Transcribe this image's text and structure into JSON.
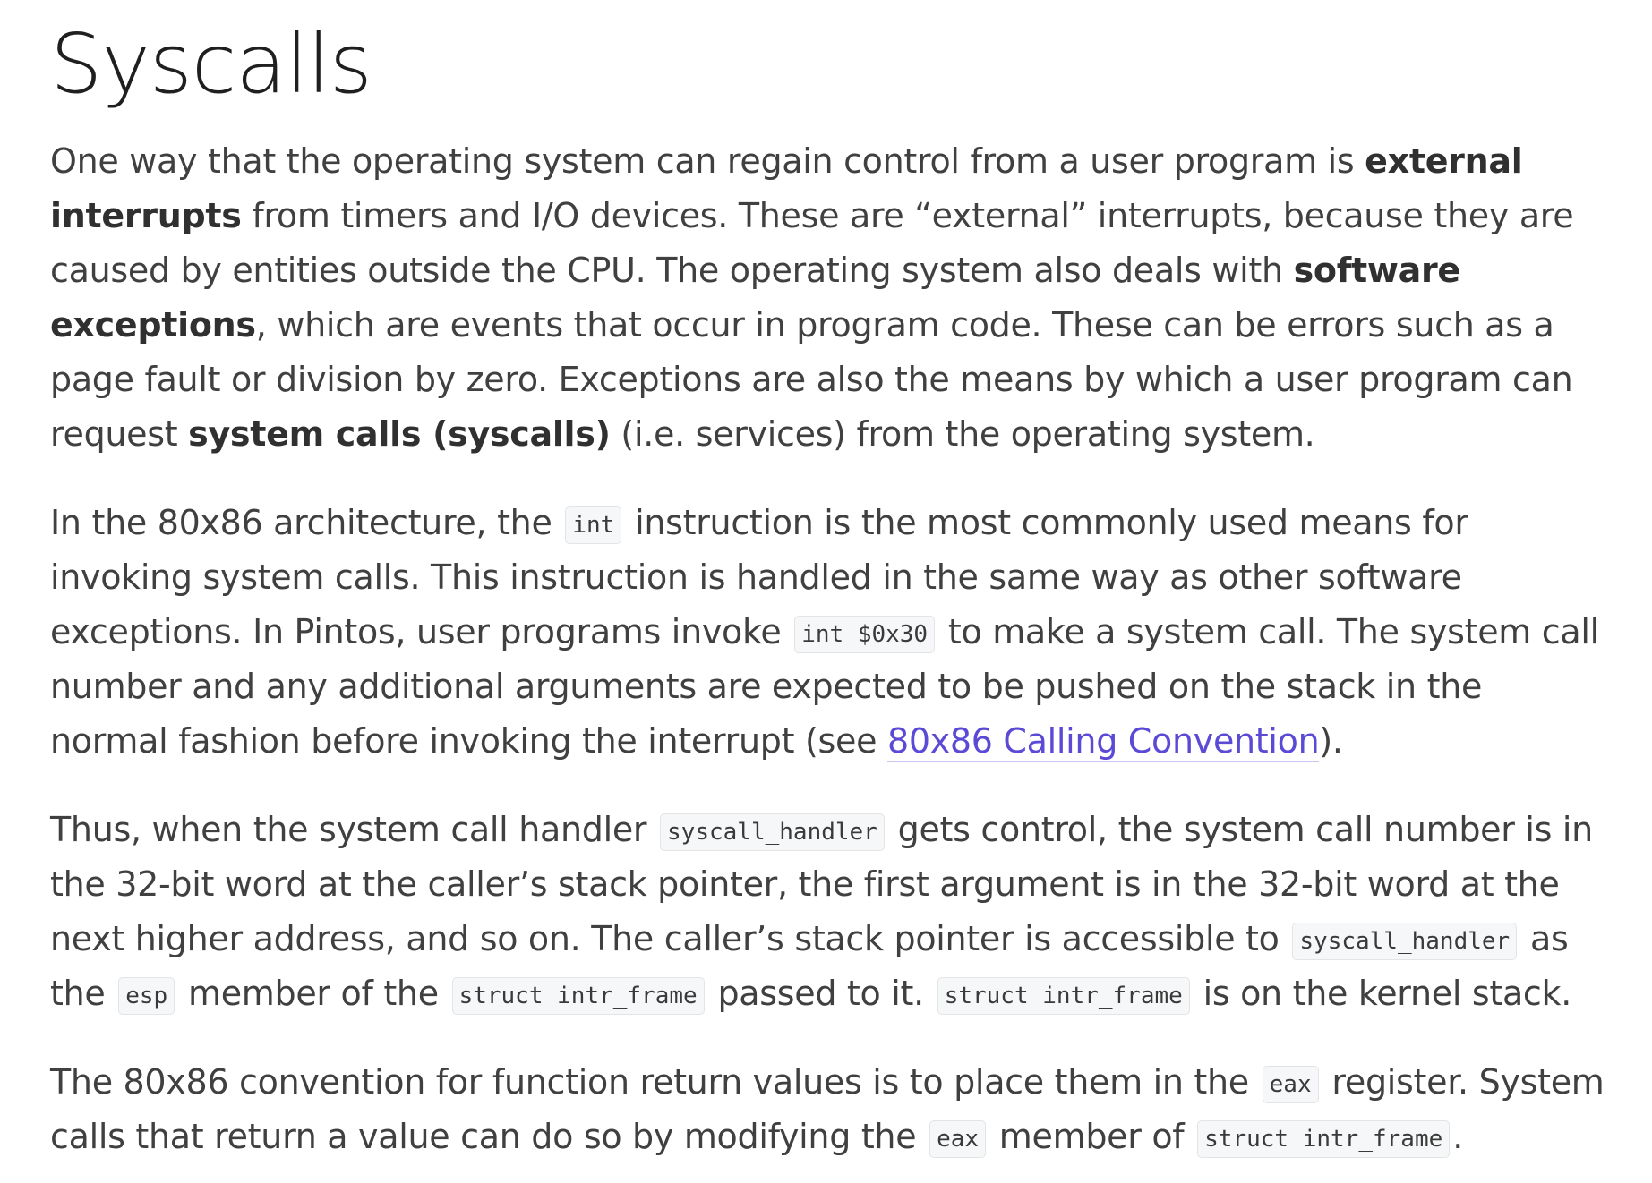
{
  "page_title": "Syscalls",
  "p1": {
    "t1": "One way that the operating system can regain control from a user program is ",
    "b1": "external interrupts",
    "t2": " from timers and I/O devices. These are “external” interrupts, because they are caused by entities outside the CPU. The operating system also deals with ",
    "b2": "software exceptions",
    "t3": ", which are events that occur in program code. These can be errors such as a page fault or division by zero. Exceptions are also the means by which a user program can request ",
    "b3": "system calls (syscalls)",
    "t4": " (i.e. services) from the operating system."
  },
  "p2": {
    "t1": "In the 80x86 architecture, the ",
    "c1": "int",
    "t2": " instruction is the most commonly used means for invoking system calls. This instruction is handled in the same way as other software exceptions. In Pintos, user programs invoke ",
    "c2": "int $0x30",
    "t3": " to make a system call. The system call number and any additional arguments are expected to be pushed on the stack in the normal fashion before invoking the interrupt (see ",
    "link": "80x86 Calling Convention",
    "t4": ")."
  },
  "p3": {
    "t1": "Thus, when the system call handler ",
    "c1": "syscall_handler",
    "t2": " gets control, the system call number is in the 32-bit word at the caller’s stack pointer, the first argument is in the 32-bit word at the next higher address, and so on. The caller’s stack pointer is accessible to ",
    "c2": "syscall_handler",
    "t3": " as the ",
    "c3": "esp",
    "t4": " member of the ",
    "c4": "struct intr_frame",
    "t5": " passed to it. ",
    "c5": "struct intr_frame",
    "t6": " is on the kernel stack."
  },
  "p4": {
    "t1": "The 80x86 convention for function return values is to place them in the ",
    "c1": "eax",
    "t2": " register. System calls that return a value can do so by modifying the ",
    "c2": "eax",
    "t3": " member of ",
    "c3": "struct intr_frame",
    "t4": "."
  },
  "colors": {
    "text": "#404040",
    "heading": "#1f1f1f",
    "link": "#5b4ad6",
    "code_bg": "#f6f7f8",
    "code_border": "#e2e4e6"
  }
}
